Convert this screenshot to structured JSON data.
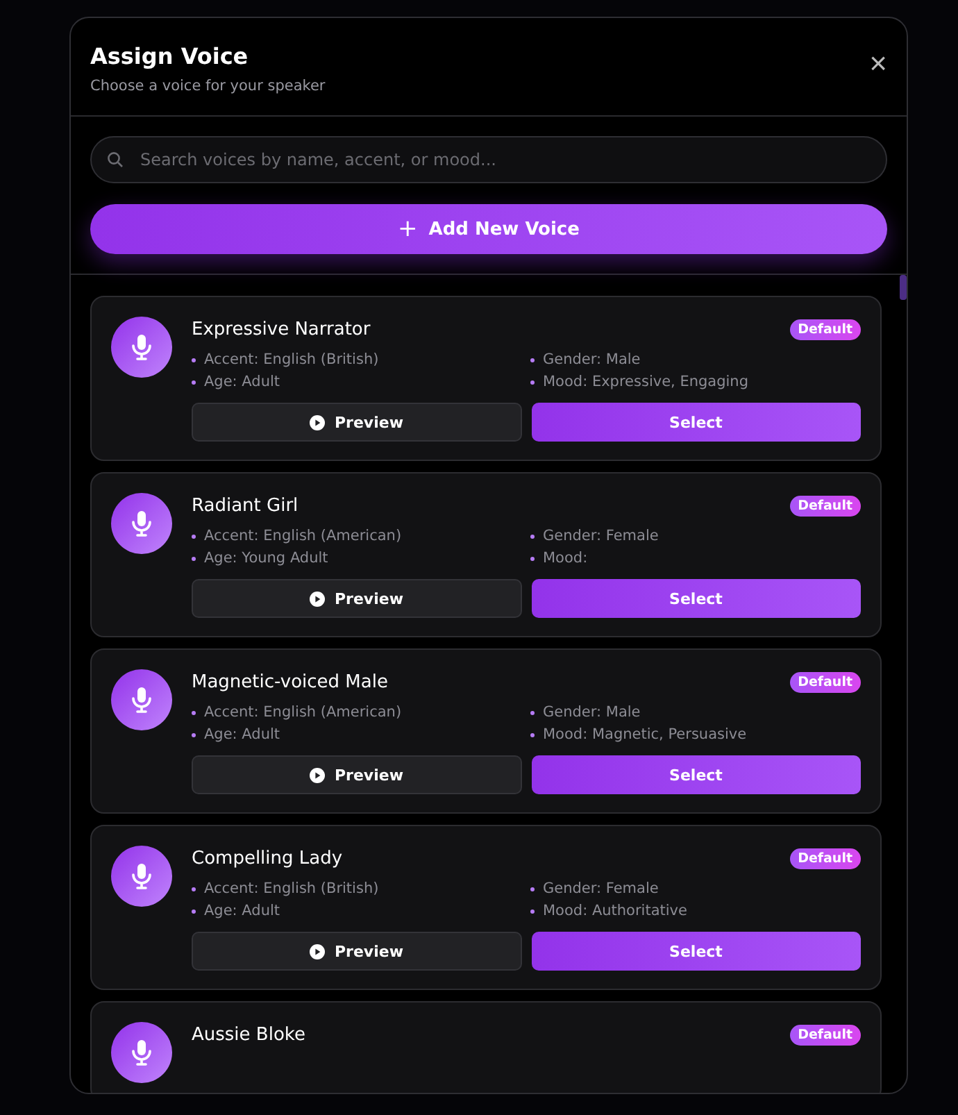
{
  "dialog": {
    "title": "Assign Voice",
    "subtitle": "Choose a voice for your speaker",
    "close": "×"
  },
  "search": {
    "placeholder": "Search voices by name, accent, or mood..."
  },
  "add_button": {
    "icon": "+",
    "label": "Add New Voice"
  },
  "voices": [
    {
      "name": "Expressive Narrator",
      "badge": "Default",
      "details": [
        "Accent: English (British)",
        "Gender: Male",
        "Age: Adult",
        "Mood: Expressive, Engaging"
      ],
      "preview": "Preview",
      "select": "Select"
    },
    {
      "name": "Radiant Girl",
      "badge": "Default",
      "details": [
        "Accent: English (American)",
        "Gender: Female",
        "Age: Young Adult",
        "Mood:"
      ],
      "preview": "Preview",
      "select": "Select"
    },
    {
      "name": "Magnetic-voiced Male",
      "badge": "Default",
      "details": [
        "Accent: English (American)",
        "Gender: Male",
        "Age: Adult",
        "Mood: Magnetic, Persuasive"
      ],
      "preview": "Preview",
      "select": "Select"
    },
    {
      "name": "Compelling Lady",
      "badge": "Default",
      "details": [
        "Accent: English (British)",
        "Gender: Female",
        "Age: Adult",
        "Mood: Authoritative"
      ],
      "preview": "Preview",
      "select": "Select"
    },
    {
      "name": "Aussie Bloke",
      "badge": "Default"
    }
  ]
}
